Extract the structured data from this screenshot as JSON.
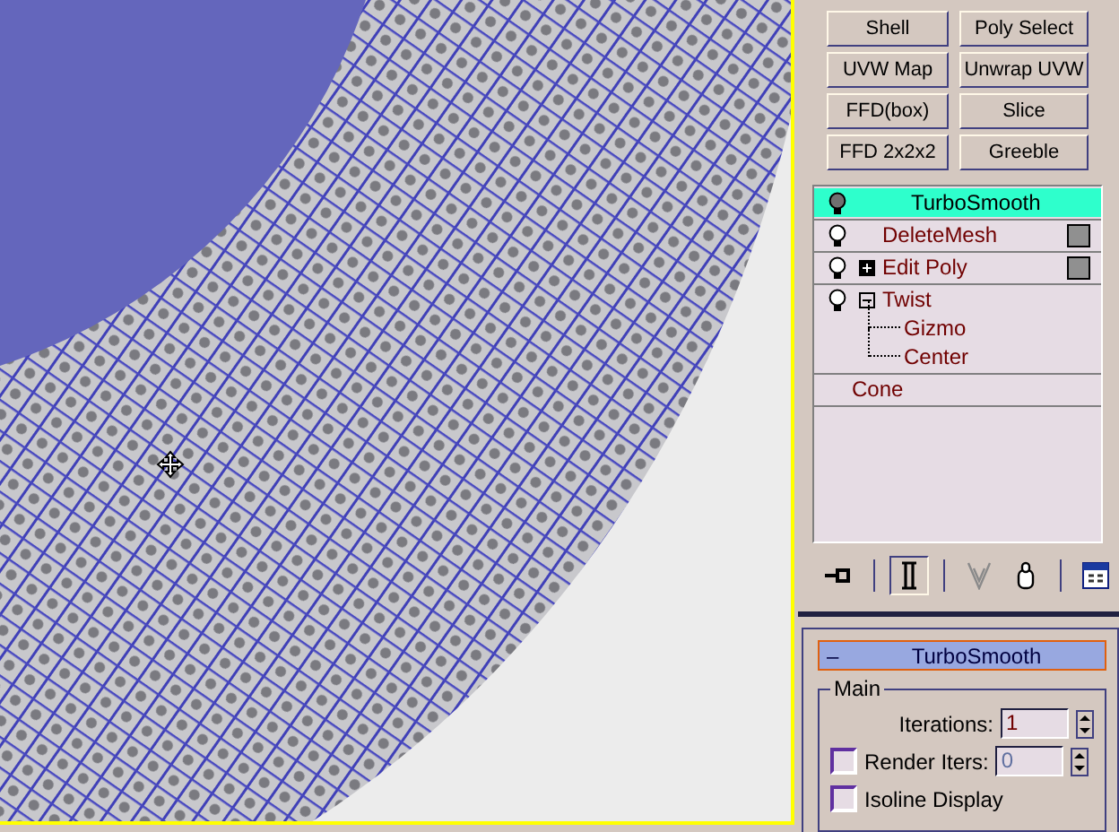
{
  "modifier_buttons": [
    {
      "label": "Shell"
    },
    {
      "label": "Poly Select"
    },
    {
      "label": "UVW Map"
    },
    {
      "label": "Unwrap UVW"
    },
    {
      "label": "FFD(box)"
    },
    {
      "label": "Slice"
    },
    {
      "label": "FFD 2x2x2"
    },
    {
      "label": "Greeble"
    }
  ],
  "modifier_stack": [
    {
      "kind": "modifier",
      "label": "TurboSmooth",
      "selected": true,
      "enabled": true,
      "box": false
    },
    {
      "kind": "modifier",
      "label": "DeleteMesh",
      "selected": false,
      "enabled": true,
      "box": true
    },
    {
      "kind": "modifier",
      "label": "Edit Poly",
      "selected": false,
      "enabled": true,
      "box": true,
      "expanded": false
    },
    {
      "kind": "modifier",
      "label": "Twist",
      "selected": false,
      "enabled": true,
      "box": false,
      "expanded": true,
      "children": [
        {
          "label": "Gizmo",
          "selected": false
        },
        {
          "label": "Center",
          "selected": false
        }
      ]
    },
    {
      "kind": "base",
      "label": "Cone",
      "selected": false
    }
  ],
  "stack_toolbar": [
    {
      "kind": "pin",
      "pressed": false
    },
    {
      "kind": "end-result",
      "pressed": true
    },
    {
      "kind": "make-unique",
      "pressed": false
    },
    {
      "kind": "remove",
      "pressed": false
    },
    {
      "kind": "configure",
      "pressed": false
    }
  ],
  "rollout": {
    "title": "TurboSmooth",
    "toggle": "–",
    "expanded": true,
    "group": "Main",
    "rows": [
      {
        "kind": "spinner",
        "label": "Iterations:",
        "value": "1",
        "disabled": false
      },
      {
        "kind": "check-spinner",
        "label": "Render Iters:",
        "checked": false,
        "value": "0",
        "disabled": true
      },
      {
        "kind": "check",
        "label": "Isoline Display",
        "checked": false
      }
    ]
  }
}
